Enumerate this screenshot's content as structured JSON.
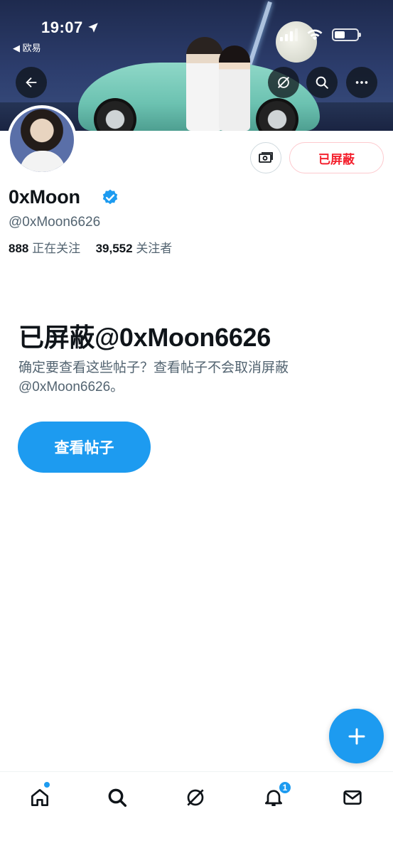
{
  "status_bar": {
    "time": "19:07",
    "back_app": "◀ 欧易"
  },
  "header": {
    "back_icon": "arrow-left-icon",
    "grok_icon": "grok-icon",
    "search_icon": "search-icon",
    "more_icon": "more-horizontal-icon"
  },
  "profile": {
    "display_name": "0xMoon",
    "handle": "@0xMoon6626",
    "following_count": "888",
    "following_label": "正在关注",
    "followers_count": "39,552",
    "followers_label": "关注者",
    "blocked_button_label": "已屏蔽",
    "tip_icon": "money-icon"
  },
  "blocked_notice": {
    "title": "已屏蔽@0xMoon6626",
    "description": "确定要查看这些帖子？查看帖子不会取消屏蔽@0xMoon6626。",
    "button_label": "查看帖子"
  },
  "tabbar": {
    "items": [
      {
        "name": "home",
        "icon": "home-icon"
      },
      {
        "name": "search",
        "icon": "search-icon"
      },
      {
        "name": "grok",
        "icon": "grok-icon"
      },
      {
        "name": "notifications",
        "icon": "bell-icon",
        "badge": "1"
      },
      {
        "name": "messages",
        "icon": "mail-icon"
      }
    ]
  },
  "colors": {
    "accent": "#1d9bf0",
    "danger": "#f4212e",
    "text_primary": "#0f1419",
    "text_secondary": "#536471"
  }
}
